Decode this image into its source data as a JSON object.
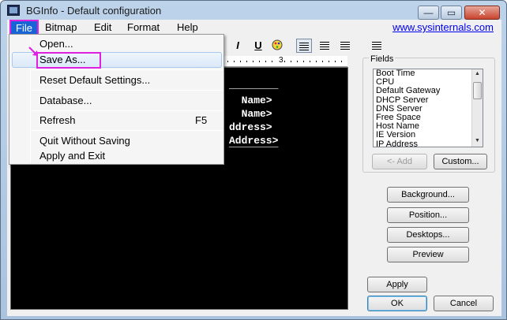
{
  "window": {
    "title": "BGInfo - Default configuration",
    "min_glyph": "—",
    "max_glyph": "▭",
    "close_glyph": "✕"
  },
  "menubar": {
    "file": "File",
    "bitmap": "Bitmap",
    "edit": "Edit",
    "format": "Format",
    "help": "Help",
    "link": "www.sysinternals.com"
  },
  "toolbar": {
    "italic": "I",
    "underline": "U",
    "ruler_number": "3"
  },
  "editor": {
    "lines": [
      "________",
      "  Name>",
      "  Name>",
      "ddress>",
      "Address>",
      "________"
    ]
  },
  "fields": {
    "label": "Fields",
    "items": [
      "Boot Time",
      "CPU",
      "Default Gateway",
      "DHCP Server",
      "DNS Server",
      "Free Space",
      "Host Name",
      "IE Version",
      "IP Address"
    ],
    "add_button": "<- Add",
    "custom_button": "Custom..."
  },
  "buttons": {
    "background": "Background...",
    "position": "Position...",
    "desktops": "Desktops...",
    "preview": "Preview",
    "apply": "Apply",
    "ok": "OK",
    "cancel": "Cancel"
  },
  "file_menu": {
    "open": "Open...",
    "save_as": "Save As...",
    "reset": "Reset Default Settings...",
    "database": "Database...",
    "refresh": "Refresh",
    "refresh_shortcut": "F5",
    "quit": "Quit Without Saving",
    "apply_exit": "Apply and Exit"
  },
  "colors": {
    "highlight": "#e020e0",
    "menu_selected": "#1764d6"
  }
}
